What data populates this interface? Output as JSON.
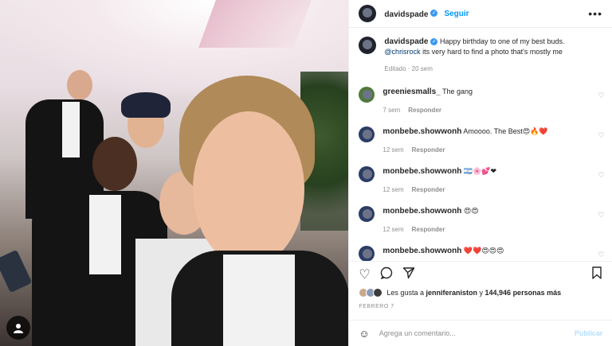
{
  "header": {
    "username": "davidspade",
    "follow_label": "Seguir",
    "more_icon": "ellipsis-icon"
  },
  "caption": {
    "username": "davidspade",
    "text": "Happy birthday to one of my best buds.",
    "mention": "@chrisrock",
    "text2": "its very hard to find a photo that's mostly me",
    "meta": "Editado · 20 sem"
  },
  "comments": [
    {
      "username": "greeniesmalls_",
      "text": "The gang",
      "time": "7 sem",
      "reply": "Responder",
      "avatar_color": "#4f7a3a"
    },
    {
      "username": "monbebe.showwonh",
      "text": "Amoooo. The Best😍🔥❤️",
      "time": "12 sem",
      "reply": "Responder",
      "avatar_color": "#2b3d66"
    },
    {
      "username": "monbebe.showwonh",
      "text": "🇦🇷🌸💕❤",
      "time": "12 sem",
      "reply": "Responder",
      "avatar_color": "#2b3d66"
    },
    {
      "username": "monbebe.showwonh",
      "text": "😍😍",
      "time": "12 sem",
      "reply": "Responder",
      "avatar_color": "#2b3d66"
    },
    {
      "username": "monbebe.showwonh",
      "text": "❤️❤️😍😍😍",
      "time": "",
      "reply": "",
      "avatar_color": "#2b3d66"
    }
  ],
  "likes": {
    "prefix": "Les gusta a",
    "user": "jenniferaniston",
    "middle": "y",
    "count": "144,946 personas más"
  },
  "date": "FEBRERO 7",
  "add_comment": {
    "placeholder": "Agrega un comentario...",
    "publish_label": "Publicar"
  },
  "colors": {
    "accent": "#0095f6",
    "verified": "#3897f0",
    "muted": "#8e8e8e"
  }
}
